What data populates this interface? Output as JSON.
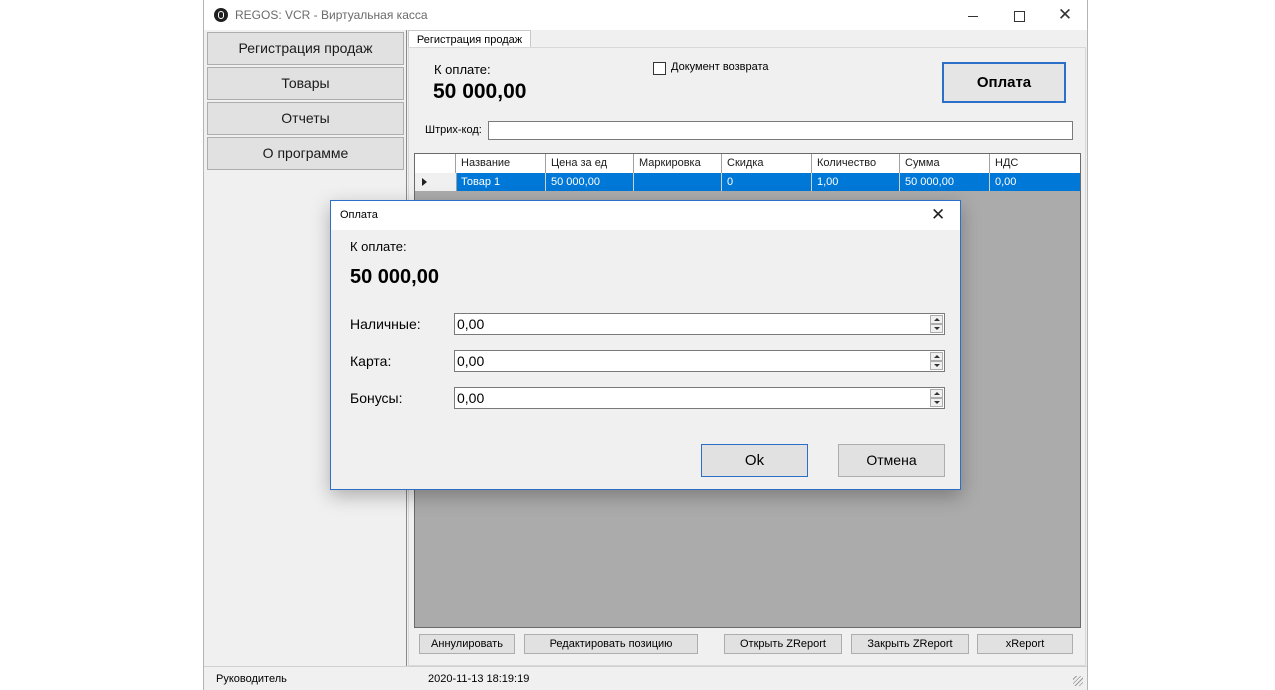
{
  "window": {
    "title": "REGOS: VCR - Виртуальная касса",
    "icon": "regos-logo-icon"
  },
  "sidebar": {
    "items": [
      {
        "label": "Регистрация продаж"
      },
      {
        "label": "Товары"
      },
      {
        "label": "Отчеты"
      },
      {
        "label": "О программе"
      }
    ]
  },
  "tab": {
    "label": "Регистрация продаж"
  },
  "sales": {
    "pay_label": "К оплате:",
    "amount": "50 000,00",
    "return_doc_label": "Документ возврата",
    "return_doc_checked": false,
    "pay_button": "Оплата",
    "barcode_label": "Штрих-код:",
    "barcode_value": ""
  },
  "grid": {
    "columns": [
      "Название",
      "Цена за ед",
      "Маркировка",
      "Скидка",
      "Количество",
      "Сумма",
      "НДС"
    ],
    "rows": [
      {
        "name": "Товар 1",
        "price": "50 000,00",
        "marking": "",
        "discount": "0",
        "qty": "1,00",
        "sum": "50 000,00",
        "vat": "0,00"
      }
    ]
  },
  "buttons": {
    "cancel_doc": "Аннулировать",
    "edit_position": "Редактировать позицию",
    "open_zreport": "Открыть ZReport",
    "close_zreport": "Закрыть ZReport",
    "xreport": "xReport"
  },
  "status": {
    "user": "Руководитель",
    "datetime": "2020-11-13 18:19:19"
  },
  "dialog": {
    "title": "Оплата",
    "pay_label": "К оплате:",
    "amount": "50 000,00",
    "fields": [
      {
        "label": "Наличные:",
        "value": "0,00"
      },
      {
        "label": "Карта:",
        "value": "0,00"
      },
      {
        "label": "Бонусы:",
        "value": "0,00"
      }
    ],
    "ok": "Ok",
    "cancel": "Отмена"
  },
  "colors": {
    "accent": "#0078d7",
    "focus_border": "#2c6fc9",
    "grid_bg": "#ababab"
  }
}
